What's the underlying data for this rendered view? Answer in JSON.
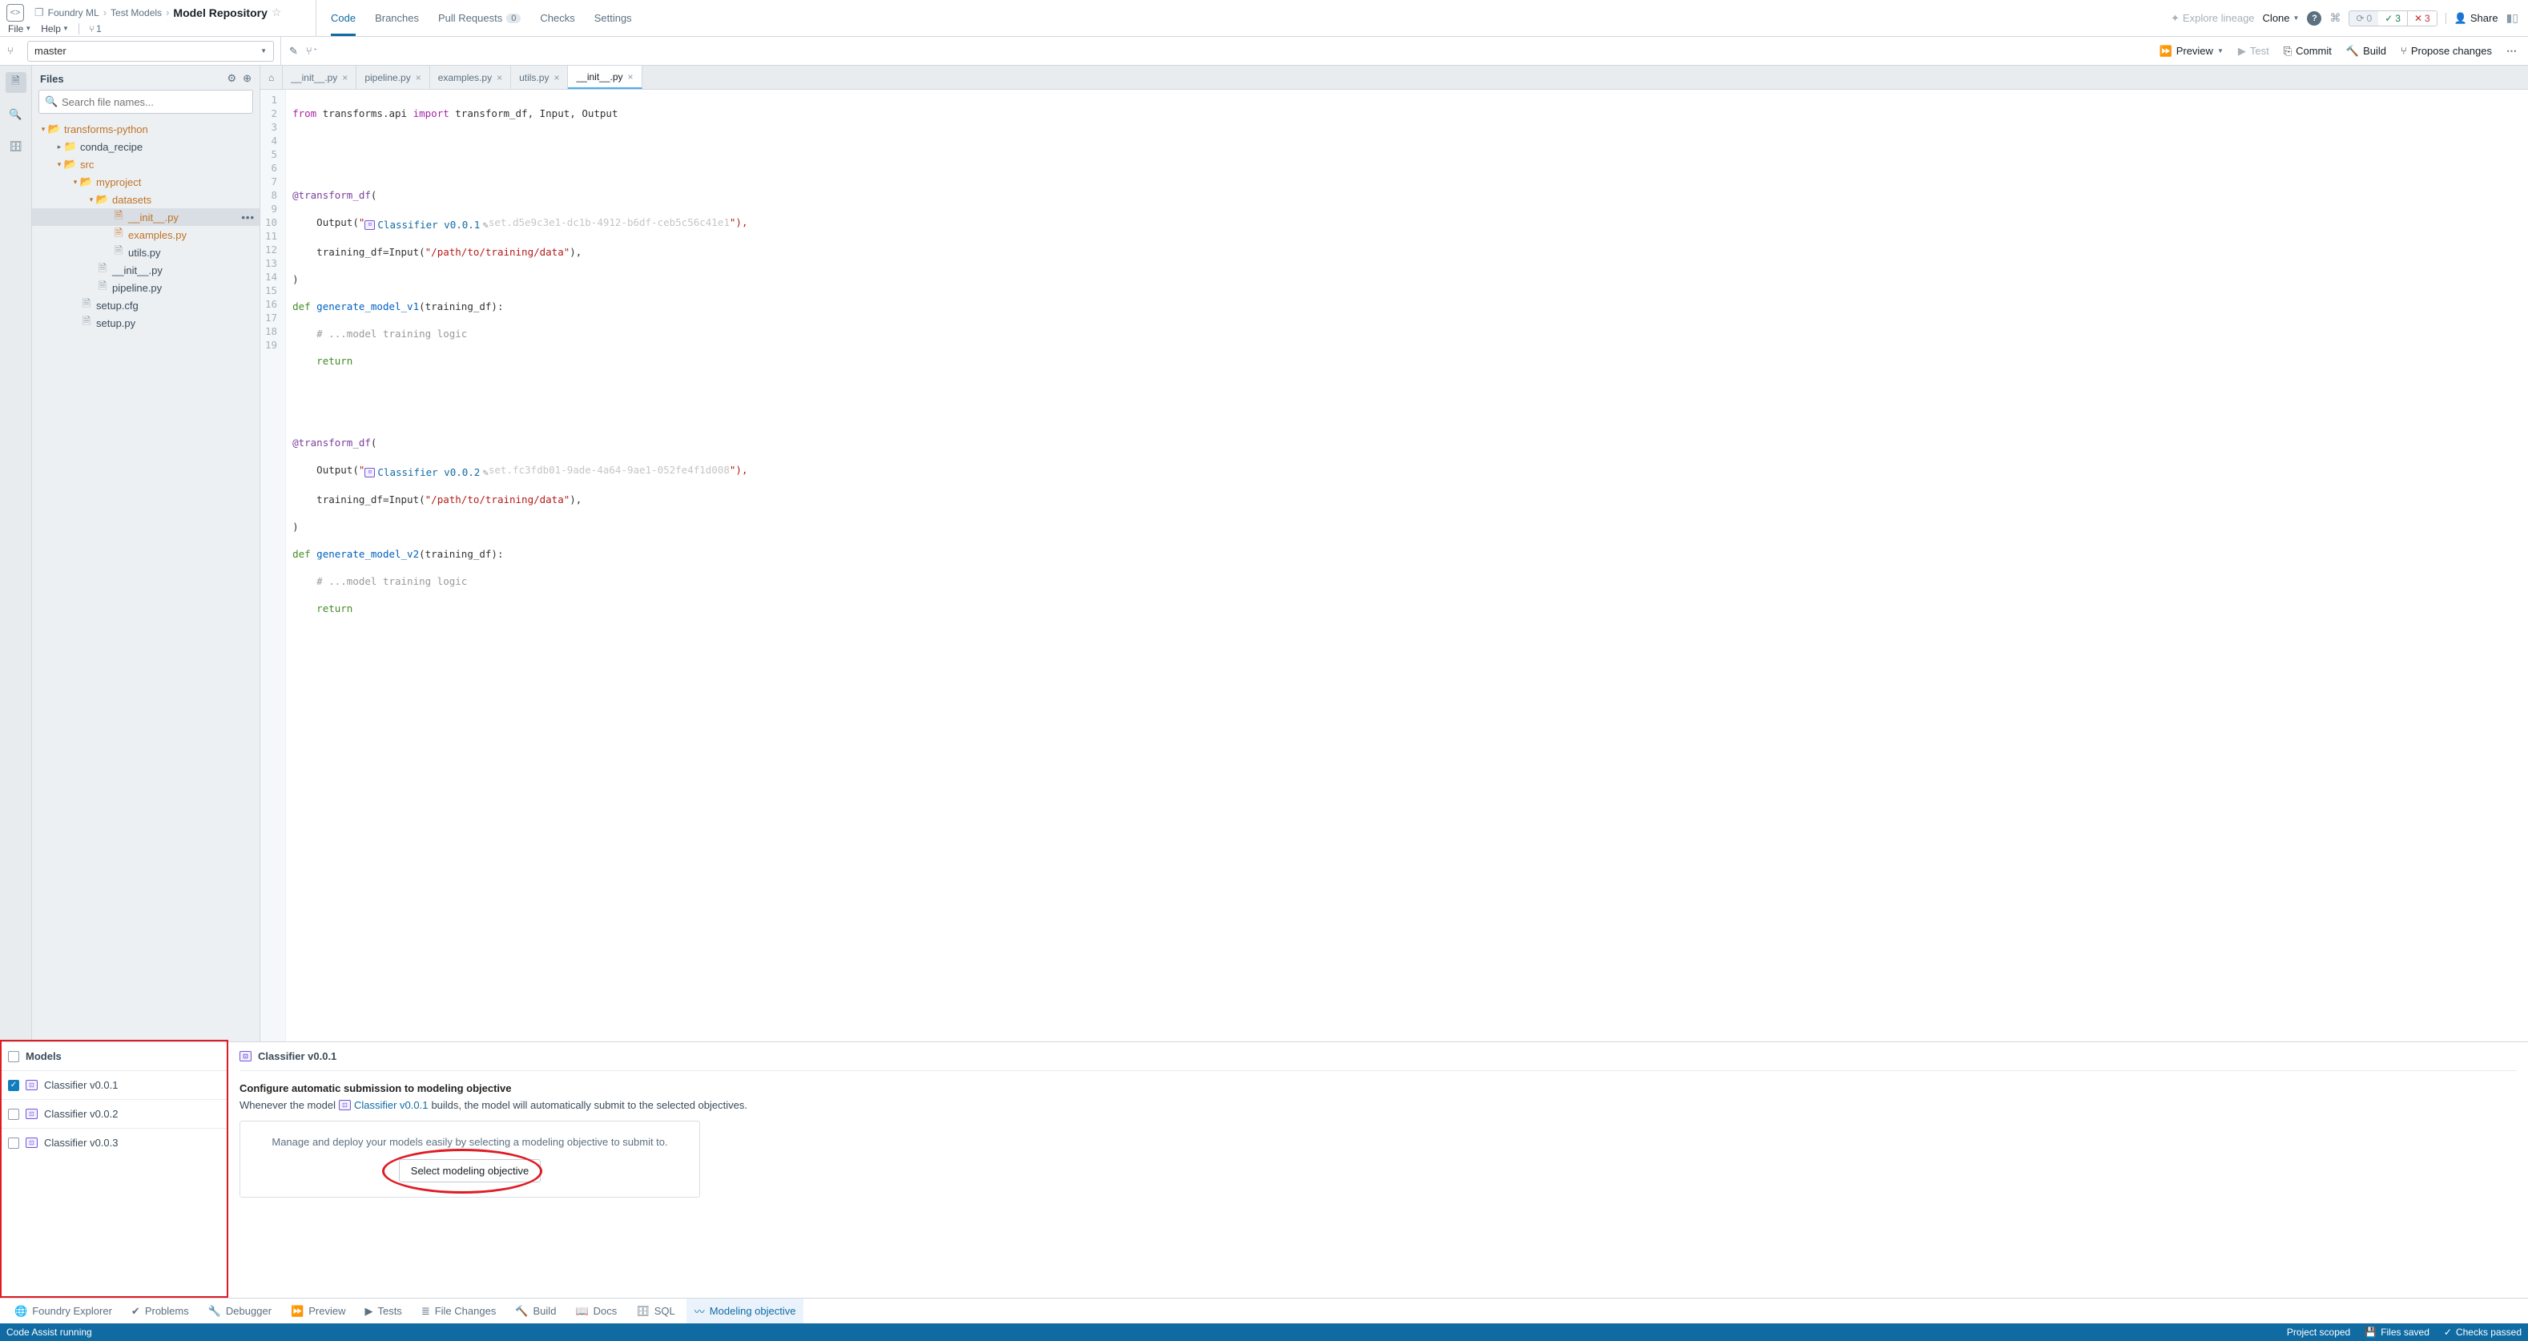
{
  "breadcrumb": {
    "workspace": "Foundry ML",
    "folder": "Test Models",
    "repo": "Model Repository"
  },
  "menus": {
    "file": "File",
    "help": "Help",
    "branch_count": "1"
  },
  "header_tabs": {
    "code": "Code",
    "branches": "Branches",
    "pulls": "Pull Requests",
    "pulls_count": "0",
    "checks": "Checks",
    "settings": "Settings"
  },
  "header_right": {
    "explore": "Explore lineage",
    "clone": "Clone",
    "share": "Share",
    "sync_count": "0",
    "ok_count": "3",
    "err_count": "3"
  },
  "branch": {
    "name": "master"
  },
  "subactions": {
    "preview": "Preview",
    "test": "Test",
    "commit": "Commit",
    "build": "Build",
    "propose": "Propose changes"
  },
  "files_panel": {
    "title": "Files",
    "search_placeholder": "Search file names..."
  },
  "tree": {
    "root": "transforms-python",
    "conda": "conda_recipe",
    "src": "src",
    "myproject": "myproject",
    "datasets": "datasets",
    "ds_init": "__init__.py",
    "ds_examples": "examples.py",
    "utils": "utils.py",
    "mp_init": "__init__.py",
    "pipeline": "pipeline.py",
    "setup_cfg": "setup.cfg",
    "setup_py": "setup.py"
  },
  "editor_tabs": {
    "t1": "__init__.py",
    "t2": "pipeline.py",
    "t3": "examples.py",
    "t4": "utils.py",
    "t5": "__init__.py"
  },
  "code": {
    "l1a": "from",
    "l1b": " transforms.api ",
    "l1c": "import",
    "l1d": " transform_df, Input, Output",
    "l4": "@transform_df",
    "l4b": "(",
    "l5a": "    Output(",
    "l5q": "\"",
    "l5chip": "Classifier v0.0.1",
    "l5hash": "set.d5e9c3e1-dc1b-4912-b6df-ceb5c56c41e1",
    "l5end": "\"),",
    "l6a": "    training_df=Input(",
    "l6b": "\"/path/to/training/data\"",
    "l6c": "),",
    "l7": ")",
    "l8a": "def",
    "l8b": " generate_model_v1",
    "l8c": "(training_df):",
    "l9": "    # ...model training logic",
    "l10a": "    ",
    "l10b": "return",
    "l13": "@transform_df",
    "l13b": "(",
    "l14a": "    Output(",
    "l14chip": "Classifier v0.0.2",
    "l14hash": "set.fc3fdb01-9ade-4a64-9ae1-052fe4f1d008",
    "l14end": "\"),",
    "l15a": "    training_df=Input(",
    "l15b": "\"/path/to/training/data\"",
    "l15c": "),",
    "l16": ")",
    "l17a": "def",
    "l17b": " generate_model_v2",
    "l17c": "(training_df):",
    "l18": "    # ...model training logic",
    "l19a": "    ",
    "l19b": "return"
  },
  "gutter": [
    "1",
    "2",
    "3",
    "4",
    "5",
    "6",
    "7",
    "8",
    "9",
    "10",
    "11",
    "12",
    "13",
    "14",
    "15",
    "16",
    "17",
    "18",
    "19"
  ],
  "models": {
    "header": "Models",
    "items": [
      "Classifier v0.0.1",
      "Classifier v0.0.2",
      "Classifier v0.0.3"
    ]
  },
  "detail": {
    "title": "Classifier v0.0.1",
    "subtitle": "Configure automatic submission to modeling objective",
    "desc_pre": "Whenever the model",
    "desc_link": "Classifier v0.0.1",
    "desc_post": "builds, the model will automatically submit to the selected objectives.",
    "card_text": "Manage and deploy your models easily by selecting a modeling objective to submit to.",
    "button": "Select modeling objective"
  },
  "btabs": {
    "explorer": "Foundry Explorer",
    "problems": "Problems",
    "debugger": "Debugger",
    "preview": "Preview",
    "tests": "Tests",
    "filechanges": "File Changes",
    "build": "Build",
    "docs": "Docs",
    "sql": "SQL",
    "modeling": "Modeling objective"
  },
  "status": {
    "assist": "Code Assist running",
    "scoped": "Project scoped",
    "saved": "Files saved",
    "passed": "Checks passed"
  }
}
